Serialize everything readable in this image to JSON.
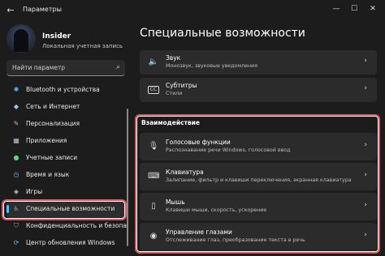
{
  "window": {
    "title": "Параметры",
    "back_glyph": "←",
    "minimize_glyph": "—",
    "maximize_glyph": "☐",
    "close_glyph": "✕"
  },
  "profile": {
    "name": "Insider",
    "account_type": "Локальная учетная запись"
  },
  "search": {
    "placeholder": "Найти параметр",
    "icon": "search-icon"
  },
  "sidebar": {
    "items": [
      {
        "label": "Bluetooth и устройства",
        "icon": "bluetooth-icon",
        "icon_color": "#4cc2ff",
        "glyph": "✱"
      },
      {
        "label": "Сеть и Интернет",
        "icon": "network-icon",
        "icon_color": "#9ac6ff",
        "glyph": "◆"
      },
      {
        "label": "Персонализация",
        "icon": "brush-icon",
        "icon_color": "#f0b37e",
        "glyph": "✎"
      },
      {
        "label": "Приложения",
        "icon": "apps-icon",
        "icon_color": "#b9c4d6",
        "glyph": "▦"
      },
      {
        "label": "Учетные записи",
        "icon": "person-icon",
        "icon_color": "#5fd38d",
        "glyph": "●"
      },
      {
        "label": "Время и язык",
        "icon": "globe-clock-icon",
        "icon_color": "#6fb7ff",
        "glyph": "◷"
      },
      {
        "label": "Игры",
        "icon": "gamepad-icon",
        "icon_color": "#c8c8c8",
        "glyph": "◈"
      },
      {
        "label": "Специальные возможности",
        "icon": "accessibility-icon",
        "icon_color": "#4cc2ff",
        "glyph": "♿",
        "active": true
      },
      {
        "label": "Конфиденциальность и безопас",
        "icon": "shield-icon",
        "icon_color": "#9aa6b8",
        "glyph": "⛉"
      },
      {
        "label": "Центр обновления Windows",
        "icon": "update-icon",
        "icon_color": "#4cc2ff",
        "glyph": "⟳"
      }
    ]
  },
  "main": {
    "title": "Специальные возможности",
    "cards_top": [
      {
        "title": "Звук",
        "subtitle": "Монозвук, звуковые уведомления",
        "icon": "speaker-icon",
        "glyph": "🔈"
      },
      {
        "title": "Субтитры",
        "subtitle": "Стили",
        "icon": "captions-icon",
        "glyph": "CC"
      }
    ],
    "section_label": "Взаимодействие",
    "cards_interaction": [
      {
        "title": "Голосовые функции",
        "subtitle": "Распознавание речи Windows, голосовой ввод",
        "icon": "microphone-icon",
        "glyph": "🎙"
      },
      {
        "title": "Клавиатура",
        "subtitle": "Залипание, фильтр и клавиши переключения, экранная клавиатура",
        "icon": "keyboard-icon",
        "glyph": "⌨"
      },
      {
        "title": "Мышь",
        "subtitle": "Клавиши мыши, скорость, ускорение",
        "icon": "mouse-icon",
        "glyph": "▯"
      },
      {
        "title": "Управление глазами",
        "subtitle": "Отслеживание глаз, преобразование текста в речь",
        "icon": "eye-control-icon",
        "glyph": "◉"
      }
    ],
    "chevron_glyph": "›"
  },
  "colors": {
    "background": "#1c1c1c",
    "card": "#2b2b2b",
    "accent": "#4cc2ff",
    "annotation": "#e05a66"
  }
}
